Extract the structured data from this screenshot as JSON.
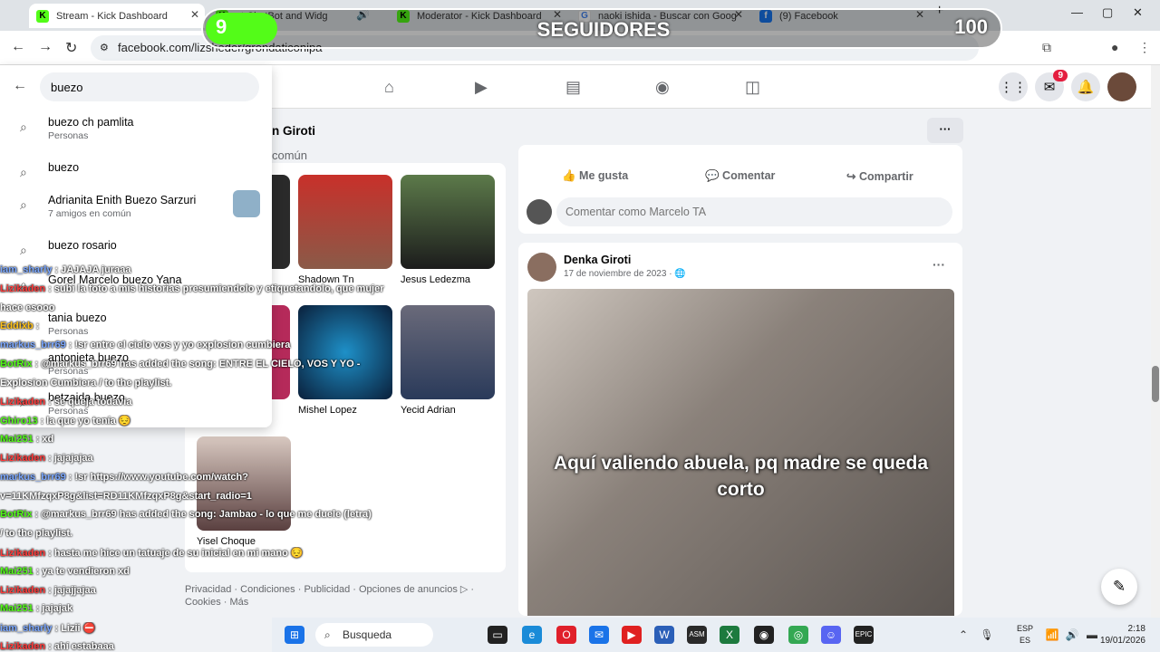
{
  "browser": {
    "tabs": [
      {
        "title": "Stream - Kick Dashboard",
        "icon": "K",
        "active": true
      },
      {
        "title": "ot ChatBot and Widg",
        "icon": "K",
        "active": false
      },
      {
        "title": "Moderator - Kick Dashboard",
        "icon": "K",
        "active": false
      },
      {
        "title": "naoki ishida - Buscar con Goog",
        "icon": "G",
        "active": false
      },
      {
        "title": "(9) Facebook",
        "icon": "f",
        "active": false
      }
    ],
    "url": "facebook.com/lizsheder/grondaticonipa"
  },
  "overlay": {
    "count": "9",
    "label": "SEGUIDORES",
    "goal": "100",
    "progress": 0.09
  },
  "facebook": {
    "notification_count": "9",
    "search": {
      "query": "buezo",
      "results": [
        {
          "title": "buezo ch pamlita",
          "subtitle": "Personas"
        },
        {
          "title": "buezo",
          "subtitle": ""
        },
        {
          "title": "Adrianita Enith Buezo Sarzuri",
          "subtitle": "7 amigos en común"
        },
        {
          "title": "buezo rosario",
          "subtitle": ""
        },
        {
          "title": "Gorel Marcelo buezo Yana",
          "subtitle": ""
        },
        {
          "title": "tania buezo",
          "subtitle": "Personas"
        },
        {
          "title": "antonieta buezo",
          "subtitle": "Personas"
        },
        {
          "title": "betzaida buezo",
          "subtitle": "Personas"
        }
      ]
    },
    "profile_title": "n Giroti",
    "profile_sub": "común",
    "friends": [
      {
        "name": "Shadown Tn"
      },
      {
        "name": "Jesus Ledezma"
      },
      {
        "name": "Mishel Lopez"
      },
      {
        "name": "Yecid Adrian"
      },
      {
        "name": "Yisel Choque"
      }
    ],
    "footer": "Privacidad · Condiciones · Publicidad · Opciones de anuncios ▷ · Cookies · Más",
    "post_actions": {
      "like": "Me gusta",
      "comment": "Comentar",
      "share": "Compartir"
    },
    "comment_placeholder": "Comentar como Marcelo TA",
    "post": {
      "author": "Denka Giroti",
      "date": "17 de noviembre de 2023 ·",
      "caption": "Aquí valiendo abuela, pq madre se queda corto"
    }
  },
  "chat": [
    {
      "user": "iam_sharly",
      "msg": ": JAJAJA juraaa",
      "color": "#7aa7ff"
    },
    {
      "user": "Lizikaden",
      "msg": ": subi la foto a mis historias presumiendolo y etiquetandolo, que mujer",
      "color": "#ff3b3b"
    },
    {
      "user": "",
      "msg": "hace esooo",
      "color": "#ffffff"
    },
    {
      "user": "Eddixb",
      "msg": ":",
      "color": "#ffc21a"
    },
    {
      "user": "markus_brr69",
      "msg": ": !sr entre el cielo vos y yo explosion cumbiera",
      "color": "#7aa7ff"
    },
    {
      "user": "BotRix",
      "msg": ": @markus_brr69 has added the song: ENTRE EL CIELO, VOS Y YO -",
      "color": "#53fc18"
    },
    {
      "user": "",
      "msg": "Explosion Cumbiera / to the playlist.",
      "color": "#ffffff"
    },
    {
      "user": "Lizikaden",
      "msg": ": se queja todavia",
      "color": "#ff3b3b"
    },
    {
      "user": "Ghiro13",
      "msg": ": la que yo tenía 😔",
      "color": "#53fc18"
    },
    {
      "user": "Mai251",
      "msg": ": xd",
      "color": "#53fc18"
    },
    {
      "user": "Lizikaden",
      "msg": ": jajajajaa",
      "color": "#ff3b3b"
    },
    {
      "user": "markus_brr69",
      "msg": ": !sr https://www.youtube.com/watch?",
      "color": "#7aa7ff"
    },
    {
      "user": "",
      "msg": "v=11KMfzqxP8g&list=RD11KMfzqxP8g&start_radio=1",
      "color": "#ffffff"
    },
    {
      "user": "BotRix",
      "msg": ": @markus_brr69 has added the song: Jambao - lo que me duele (letra)",
      "color": "#53fc18"
    },
    {
      "user": "",
      "msg": "/ to the playlist.",
      "color": "#ffffff"
    },
    {
      "user": "Lizikaden",
      "msg": ": hasta me hice un tatuaje de su inicial en mi mano 😔",
      "color": "#ff3b3b"
    },
    {
      "user": "Mai251",
      "msg": ": ya te vendieron xd",
      "color": "#53fc18"
    },
    {
      "user": "Lizikaden",
      "msg": ": jajajjajaa",
      "color": "#ff3b3b"
    },
    {
      "user": "Mai251",
      "msg": ": jajajak",
      "color": "#53fc18"
    },
    {
      "user": "iam_sharly",
      "msg": ": Lizii ⛔",
      "color": "#7aa7ff"
    },
    {
      "user": "Lizikaden",
      "msg": ": ahí estabaaa",
      "color": "#ff3b3b"
    }
  ],
  "taskbar": {
    "search_label": "Busqueda",
    "lang": "ESP",
    "region": "ES",
    "time": "2:18",
    "date": "19/01/2026"
  }
}
